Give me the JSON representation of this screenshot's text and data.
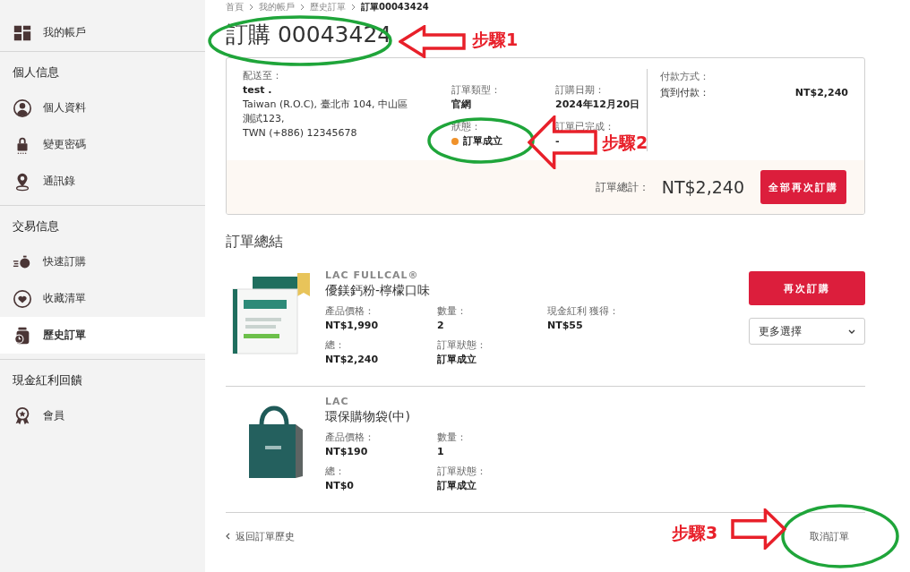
{
  "sidebar": {
    "sections": [
      {
        "items": [
          {
            "label": "我的帳戶",
            "selected": false
          }
        ]
      },
      {
        "title": "個人信息",
        "items": [
          {
            "label": "個人資料",
            "selected": false
          },
          {
            "label": "變更密碼",
            "selected": false
          },
          {
            "label": "通訊錄",
            "selected": false
          }
        ]
      },
      {
        "title": "交易信息",
        "items": [
          {
            "label": "快速訂購",
            "selected": false
          },
          {
            "label": "收藏清單",
            "selected": false
          },
          {
            "label": "歷史訂單",
            "selected": true
          }
        ]
      },
      {
        "title": "現金紅利回饋",
        "items": [
          {
            "label": "會員",
            "selected": false
          }
        ]
      }
    ]
  },
  "breadcrumb": [
    "首頁",
    "我的帳戶",
    "歷史訂單",
    "訂單00043424"
  ],
  "title": "訂購 00043424",
  "order": {
    "ship_label": "配送至：",
    "ship_name": "test .",
    "ship_lines": [
      "Taiwan (R.O.C), 臺北市 104, 中山區",
      "測試123,",
      "TWN (+886) 12345678"
    ],
    "type_label": "訂單類型：",
    "type_value": "官網",
    "date_label": "訂購日期：",
    "date_value": "2024年12月20日",
    "status_label": "狀態：",
    "status": {
      "text": "訂單成立",
      "color": "#f0922b"
    },
    "done_label": "訂單已完成：",
    "done_value": "-",
    "payment_label": "付款方式：",
    "payment_method": "貨到付款：",
    "payment_amount": "NT$2,240",
    "total_label": "訂單總計：",
    "total_value": "NT$2,240",
    "reorder_all": "全部再次訂購"
  },
  "summary_title": "訂單總結",
  "products": [
    {
      "kind": "box",
      "brand": "LAC FULLCAL®",
      "name": "優鎂鈣粉-檸檬口味",
      "fields": [
        {
          "label": "產品價格：",
          "value": "NT$1,990"
        },
        {
          "label": "數量：",
          "value": "2"
        },
        {
          "label": "現金紅利 獲得：",
          "value": "NT$55"
        },
        {
          "label": "總：",
          "value": "NT$2,240"
        },
        {
          "label": "訂單狀態：",
          "value": "訂單成立"
        }
      ],
      "reorder": "再次訂購",
      "more": "更多選擇"
    },
    {
      "kind": "bag",
      "brand": "LAC",
      "name": "環保購物袋(中)",
      "fields": [
        {
          "label": "產品價格：",
          "value": "NT$190"
        },
        {
          "label": "數量：",
          "value": "1"
        },
        {
          "label": "總：",
          "value": "NT$0"
        },
        {
          "label": "訂單狀態：",
          "value": "訂單成立"
        }
      ]
    }
  ],
  "back_link": "返回訂單歷史",
  "cancel_link": "取消訂單",
  "annotations": [
    {
      "label": "步驟1"
    },
    {
      "label": "步驟2"
    },
    {
      "label": "步驟3"
    }
  ]
}
